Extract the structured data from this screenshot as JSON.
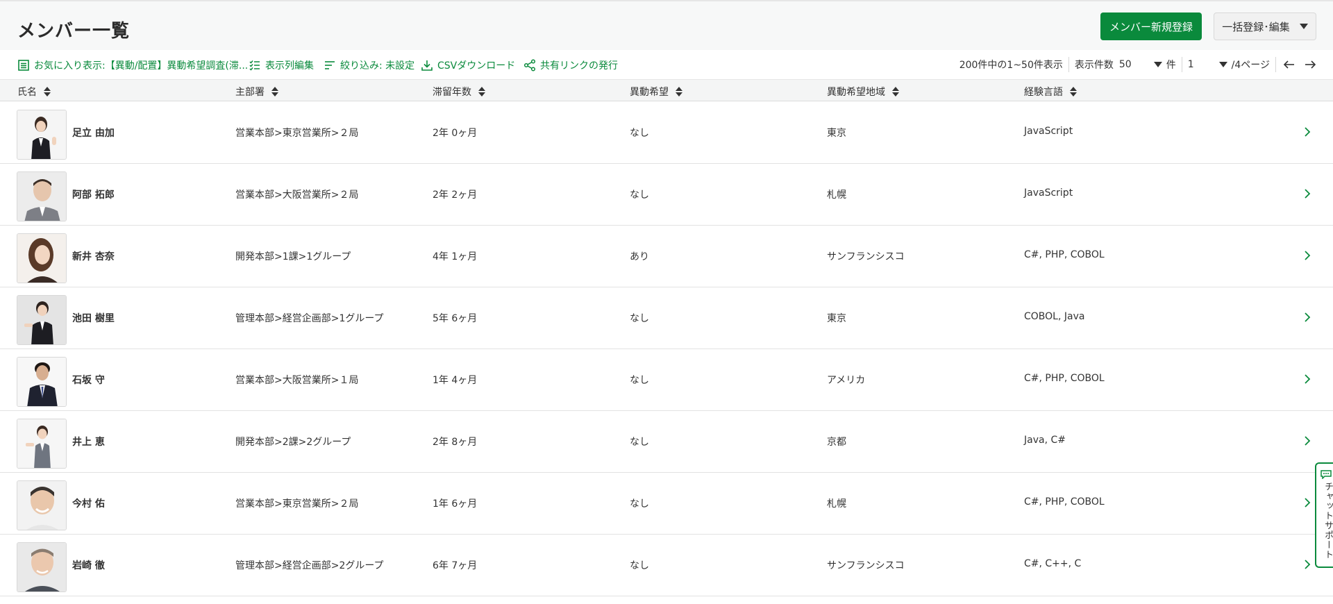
{
  "header": {
    "title": "メンバー一覧",
    "new_member_button": "メンバー新規登録",
    "bulk_button": "一括登録･編集"
  },
  "toolbar": {
    "favorite_label": "お気に入り表示:【異動/配置】異動希望調査(滞...",
    "columns_label": "表示列編集",
    "filter_label": "絞り込み: 未設定",
    "csv_label": "CSVダウンロード",
    "share_label": "共有リンクの発行"
  },
  "pager": {
    "summary": "200件中の1~50件表示",
    "per_page_label": "表示件数",
    "per_page_value": "50",
    "per_page_unit": "件",
    "page_value": "1",
    "page_total": "/4ページ"
  },
  "columns": [
    "氏名",
    "主部署",
    "滞留年数",
    "異動希望",
    "異動希望地域",
    "経験言語"
  ],
  "members": [
    {
      "name": "足立 由加",
      "dept": "営業本部>東京営業所>２局",
      "years": "2年 0ヶ月",
      "move": "なし",
      "area": "東京",
      "langs": "JavaScript",
      "avatar": "woman-1"
    },
    {
      "name": "阿部 拓郎",
      "dept": "営業本部>大阪営業所>２局",
      "years": "2年 2ヶ月",
      "move": "なし",
      "area": "札幌",
      "langs": "JavaScript",
      "avatar": "man-1"
    },
    {
      "name": "新井 杏奈",
      "dept": "開発本部>1課>1グループ",
      "years": "4年 1ヶ月",
      "move": "あり",
      "area": "サンフランシスコ",
      "langs": "C#, PHP, COBOL",
      "avatar": "woman-2"
    },
    {
      "name": "池田 樹里",
      "dept": "管理本部>経営企画部>1グループ",
      "years": "5年 6ヶ月",
      "move": "なし",
      "area": "東京",
      "langs": "COBOL, Java",
      "avatar": "woman-3"
    },
    {
      "name": "石坂 守",
      "dept": "営業本部>大阪営業所>１局",
      "years": "1年 4ヶ月",
      "move": "なし",
      "area": "アメリカ",
      "langs": "C#, PHP, COBOL",
      "avatar": "man-2"
    },
    {
      "name": "井上 恵",
      "dept": "開発本部>2課>2グループ",
      "years": "2年 8ヶ月",
      "move": "なし",
      "area": "京都",
      "langs": "Java, C#",
      "avatar": "woman-4"
    },
    {
      "name": "今村 佑",
      "dept": "営業本部>東京営業所>２局",
      "years": "1年 6ヶ月",
      "move": "なし",
      "area": "札幌",
      "langs": "C#, PHP, COBOL",
      "avatar": "man-3"
    },
    {
      "name": "岩崎 徹",
      "dept": "管理本部>経営企画部>2グループ",
      "years": "6年 7ヶ月",
      "move": "なし",
      "area": "サンフランシスコ",
      "langs": "C#, C++, C",
      "avatar": "man-4"
    }
  ],
  "chat_support": "チャットサポート",
  "colors": {
    "accent": "#0a8a3c",
    "header_bg": "#f7f8f8",
    "table_head_bg": "#f4f5f5",
    "border": "#e2e2e2"
  }
}
